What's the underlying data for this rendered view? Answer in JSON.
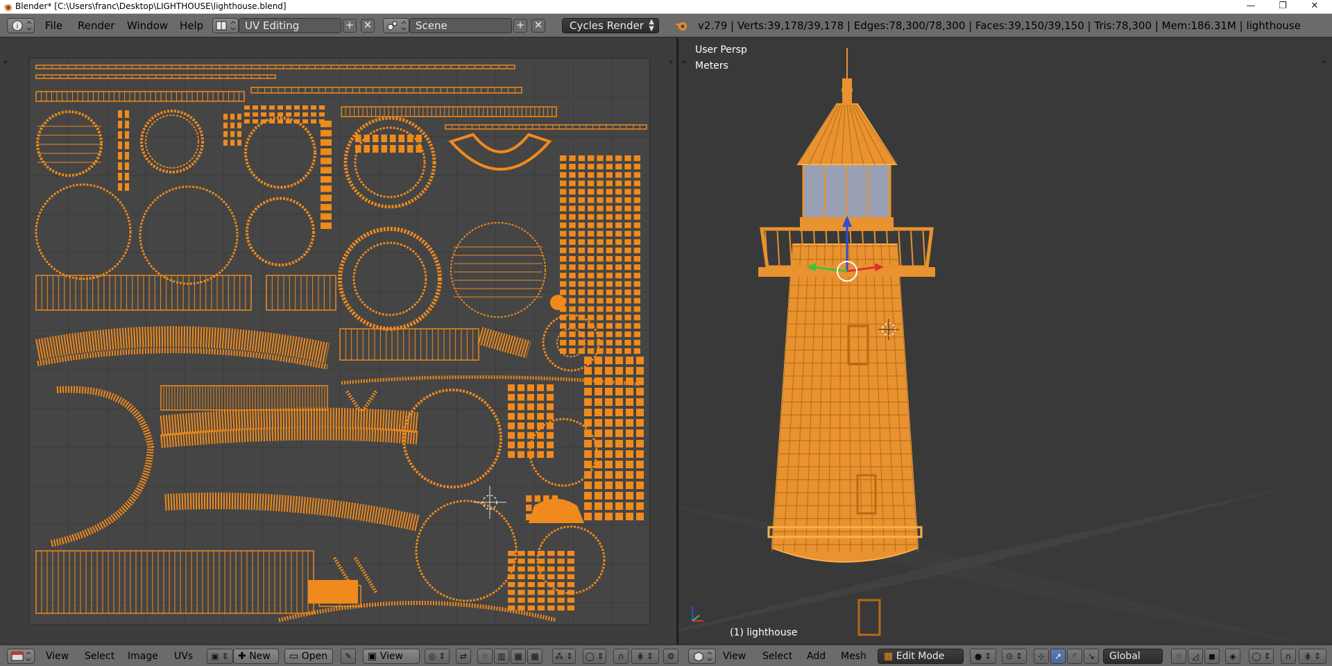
{
  "window": {
    "title": "Blender* [C:\\Users\\franc\\Desktop\\LIGHTHOUSE\\lighthouse.blend]",
    "minimize": "—",
    "maximize": "❐",
    "close": "✕"
  },
  "infobar": {
    "menu": [
      "File",
      "Render",
      "Window",
      "Help"
    ],
    "screen_layout": "UV Editing",
    "scene": "Scene",
    "render_engine": "Cycles Render",
    "stats": "v2.79 | Verts:39,178/39,178 | Edges:78,300/78,300 | Faces:39,150/39,150 | Tris:78,300 | Mem:186.31M | lighthouse"
  },
  "viewport": {
    "view_name": "User Persp",
    "units": "Meters",
    "object_label": "(1) lighthouse"
  },
  "uv_header": {
    "menu": [
      "View",
      "Select",
      "Image",
      "UVs"
    ],
    "new_label": "New",
    "open_label": "Open",
    "view_dropdown": "View"
  },
  "view3d_header": {
    "menu": [
      "View",
      "Select",
      "Add",
      "Mesh"
    ],
    "mode": "Edit Mode",
    "orientation": "Global"
  },
  "colors": {
    "accent_orange": "#f08a1c",
    "header_gray": "#6b6b6b",
    "uv_background": "#454545",
    "viewport_background": "#393939"
  },
  "icons": [
    "blender-logo-icon",
    "info-editor-icon",
    "screen-layout-icon",
    "scene-icon",
    "add-icon",
    "close-icon",
    "image-editor-icon",
    "view3d-editor-icon",
    "pin-icon",
    "vertex-select-icon",
    "edge-select-icon",
    "face-select-icon",
    "pivot-icon",
    "proportional-edit-icon",
    "manipulator-translate-icon",
    "manipulator-rotate-icon",
    "manipulator-scale-icon"
  ]
}
